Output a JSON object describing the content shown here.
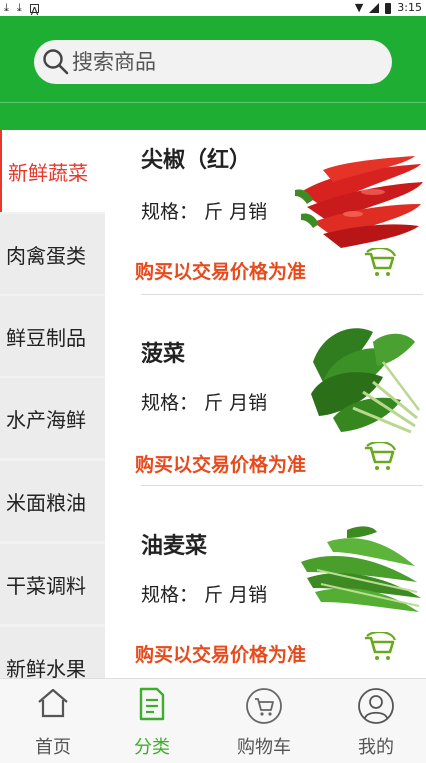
{
  "status_bar": {
    "left_icons": [
      "download-icon",
      "download-icon",
      "a-box-icon"
    ],
    "time": "3:15"
  },
  "search": {
    "placeholder": "搜索商品"
  },
  "categories": [
    {
      "label": "新鲜蔬菜",
      "active": true
    },
    {
      "label": "肉禽蛋类",
      "active": false
    },
    {
      "label": "鲜豆制品",
      "active": false
    },
    {
      "label": "水产海鲜",
      "active": false
    },
    {
      "label": "米面粮油",
      "active": false
    },
    {
      "label": "干菜调料",
      "active": false
    },
    {
      "label": "新鲜水果",
      "active": false
    }
  ],
  "products": [
    {
      "name": "尖椒（红）",
      "spec": "规格： 斤   月销",
      "price_note": "购买以交易价格为准",
      "image": "red-chili-peppers"
    },
    {
      "name": "菠菜",
      "spec": "规格： 斤   月销",
      "price_note": "购买以交易价格为准",
      "image": "spinach"
    },
    {
      "name": "油麦菜",
      "spec": "规格： 斤   月销",
      "price_note": "购买以交易价格为准",
      "image": "indian-lettuce"
    }
  ],
  "tabs": [
    {
      "label": "首页",
      "icon": "home-icon",
      "active": false
    },
    {
      "label": "分类",
      "icon": "category-icon",
      "active": true
    },
    {
      "label": "购物车",
      "icon": "cart-icon",
      "active": false
    },
    {
      "label": "我的",
      "icon": "user-icon",
      "active": false
    }
  ],
  "colors": {
    "brand_green": "#1eae33",
    "active_red": "#e8382b",
    "price_orange": "#e84a1c",
    "tab_active_green": "#3eae2a",
    "cart_green": "#6aa820"
  }
}
